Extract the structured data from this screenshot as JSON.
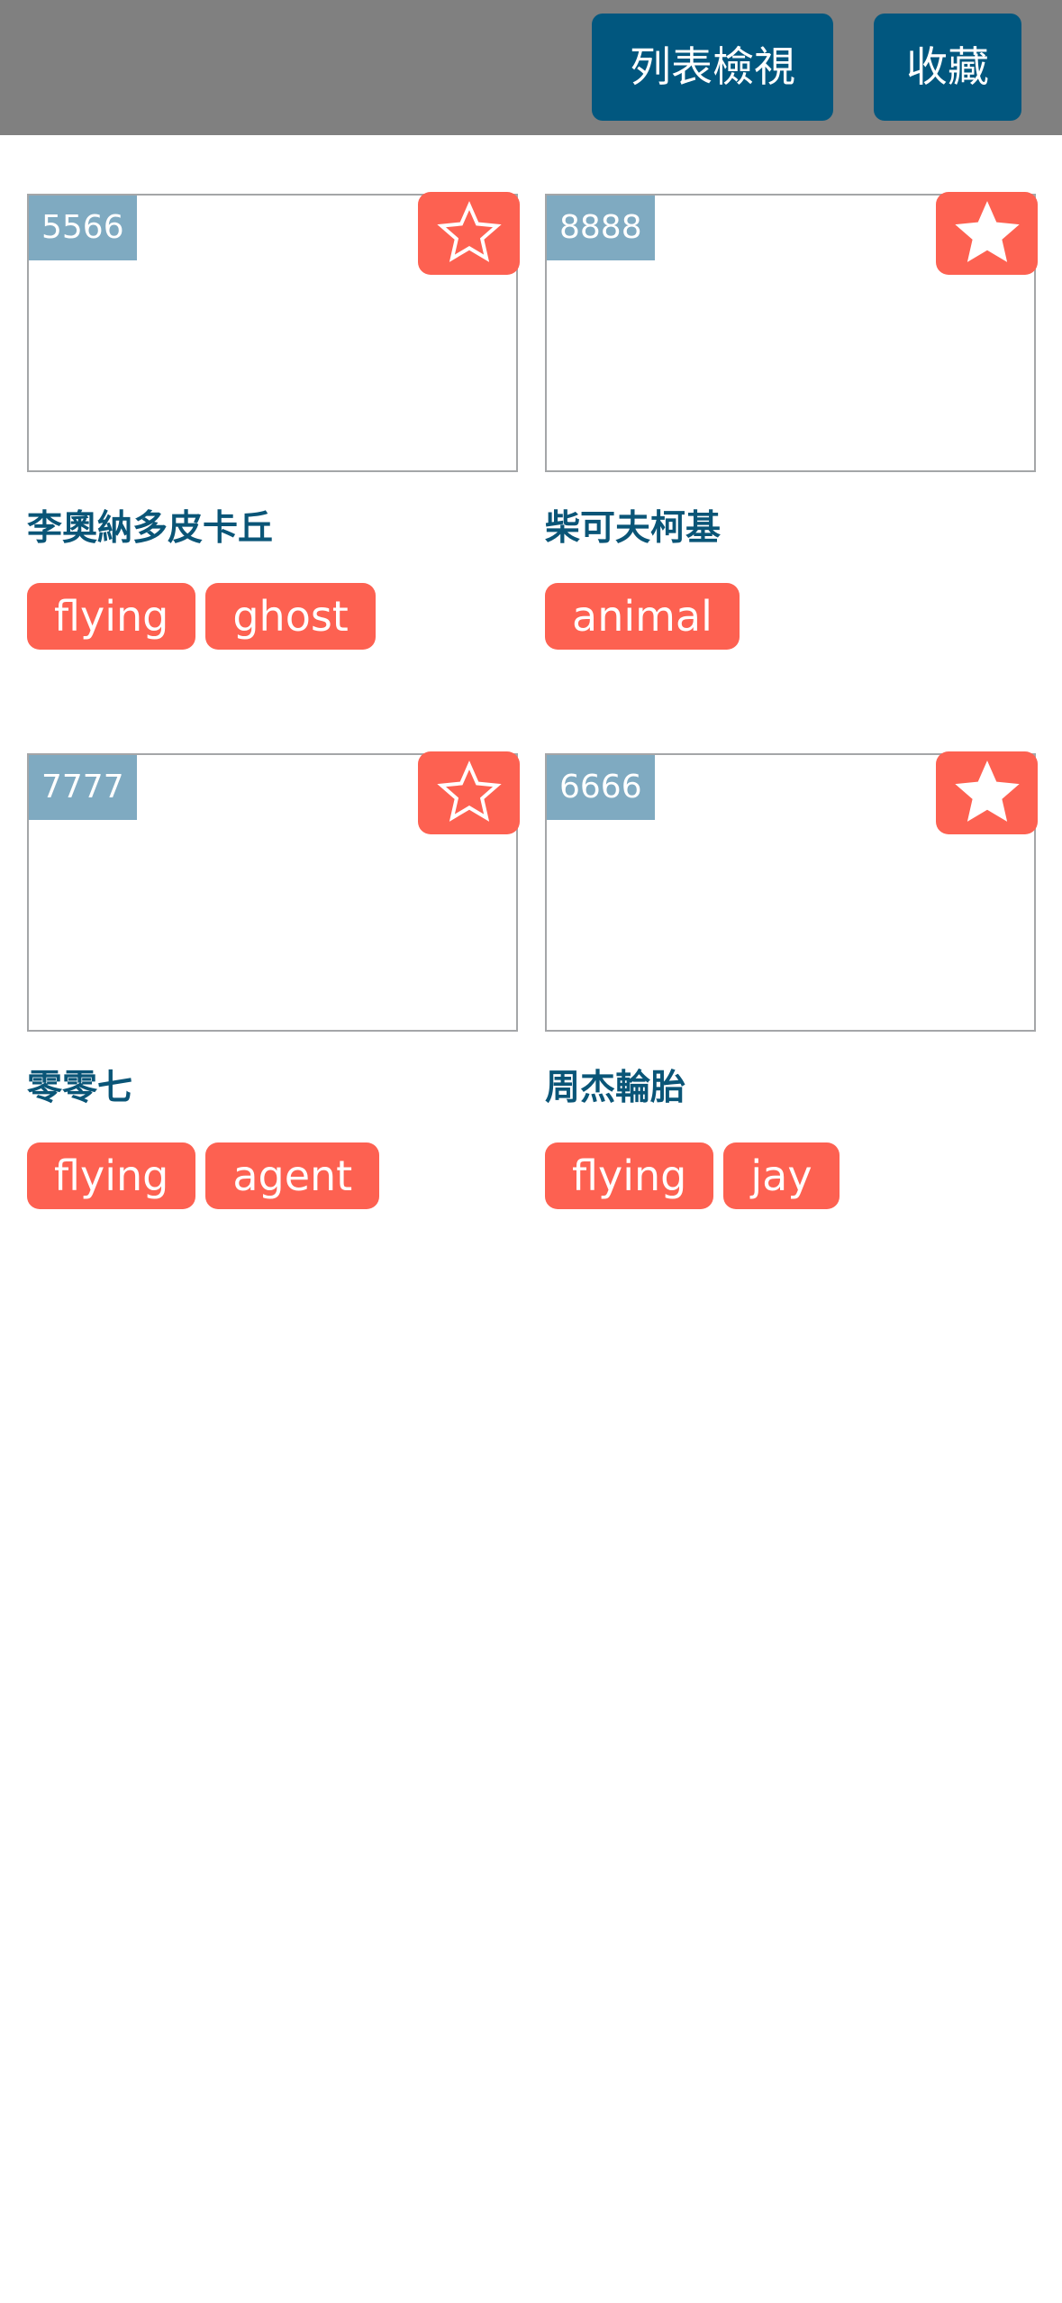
{
  "header": {
    "list_view_label": "列表檢視",
    "favorites_label": "收藏"
  },
  "cards": [
    {
      "number": "5566",
      "name": "李奧納多皮卡丘",
      "favorited": false,
      "tags": [
        "flying",
        "ghost"
      ]
    },
    {
      "number": "8888",
      "name": "柴可夫柯基",
      "favorited": true,
      "tags": [
        "animal"
      ]
    },
    {
      "number": "7777",
      "name": "零零七",
      "favorited": false,
      "tags": [
        "flying",
        "agent"
      ]
    },
    {
      "number": "6666",
      "name": "周杰輪胎",
      "favorited": true,
      "tags": [
        "flying",
        "jay"
      ]
    }
  ],
  "colors": {
    "header_bg": "#808080",
    "button_bg": "#01577f",
    "accent": "#fd6151",
    "badge_bg": "#7faac1",
    "name_text": "#0a5577"
  },
  "icons": {
    "star_outline": "star-outline-icon",
    "star_filled": "star-filled-icon"
  }
}
